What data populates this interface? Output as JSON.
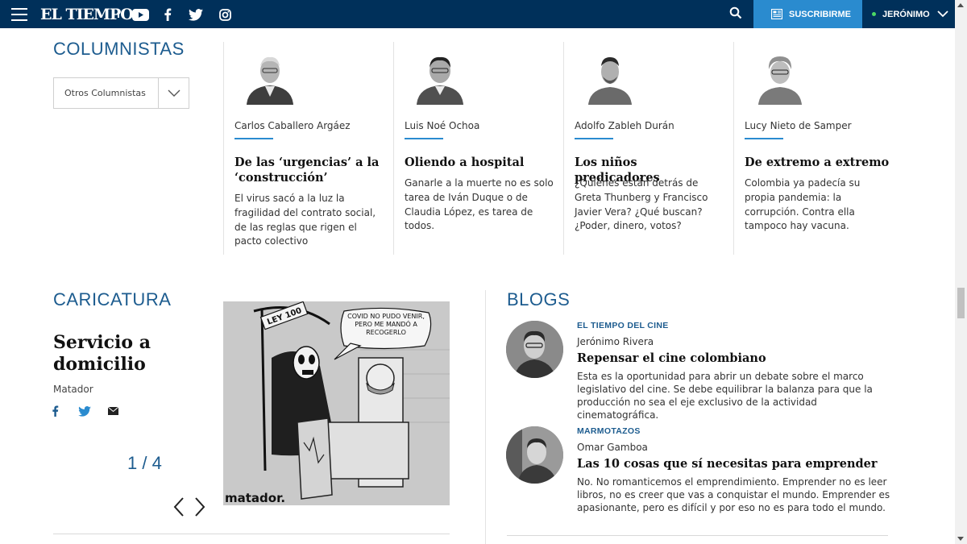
{
  "header": {
    "logo": "EL TIEMPO",
    "subscribe_label": "SUSCRIBIRME",
    "user_name": "JERÓNIMO",
    "social_icons": [
      "youtube-icon",
      "facebook-icon",
      "twitter-icon",
      "instagram-icon"
    ]
  },
  "columnistas": {
    "title": "COLUMNISTAS",
    "select_value": "Otros Columnistas",
    "items": [
      {
        "author": "Carlos Caballero Argáez",
        "headline": "De las ‘urgencias’ a la ‘construcción’",
        "desc": "El virus sacó a la luz la fragilidad del contrato social, de las reglas que rigen el pacto colectivo"
      },
      {
        "author": "Luis Noé Ochoa",
        "headline": "Oliendo a hospital",
        "desc": "Ganarle a la muerte no es solo tarea de Iván Duque o de Claudia López, es tarea de todos."
      },
      {
        "author": "Adolfo Zableh Durán",
        "headline": "Los niños predicadores",
        "desc": "¿Quiénes están detrás de Greta Thunberg y Francisco Javier Vera? ¿Qué buscan? ¿Poder, dinero, votos?"
      },
      {
        "author": "Lucy Nieto de Samper",
        "headline": "De extremo a extremo",
        "desc": "Colombia ya padecía su propia pandemia: la corrupción. Contra ella tampoco hay vacuna."
      }
    ]
  },
  "caricatura": {
    "title": "CARICATURA",
    "headline": "Servicio a domicilio",
    "author": "Matador",
    "counter": "1 / 4",
    "cartoon_sign": "LEY 100",
    "cartoon_bubble": "COVID NO PUDO VENIR, PERO ME MANDÓ A RECOGERLO",
    "cartoon_signature": "matador."
  },
  "blogs": {
    "title": "BLOGS",
    "items": [
      {
        "label": "EL TIEMPO DEL CINE",
        "author": "Jerónimo Rivera",
        "headline": "Repensar el cine colombiano",
        "desc": "Esta es la oportunidad para abrir un debate sobre el marco legislativo del cine. Se debe equilibrar la balanza para que la producción no sea el eje exclusivo de la actividad cinematográfica."
      },
      {
        "label": "MARMOTAZOS",
        "author": "Omar Gamboa",
        "headline": "Las 10 cosas que sí necesitas para emprender",
        "desc": "No. No romanticemos el emprendimiento. Emprender no es leer libros, no es creer que vas a conquistar el mundo. Emprender es apasionante, pero es difícil y por eso no es para todo el mundo."
      }
    ]
  },
  "colors": {
    "topbar": "#00305a",
    "subscribe": "#2a8bcf",
    "accent": "#1d5c8f"
  }
}
